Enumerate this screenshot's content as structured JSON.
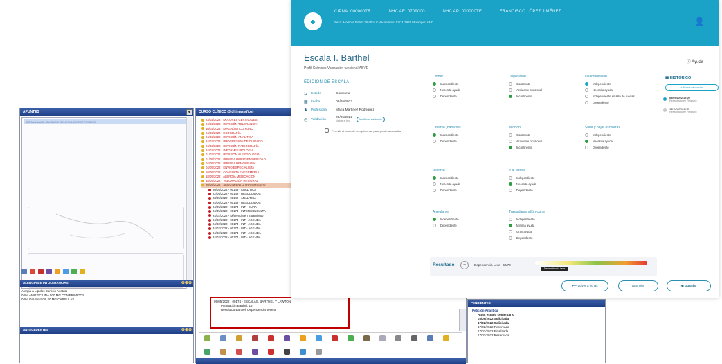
{
  "legacy": {
    "title": "APUNTES",
    "selected_item": "DD/MM/AAAA - CUIDADO GENERAL DE ENFERMERÍA",
    "section_alergias": "ALERGIAS E INTOLERANCIAS",
    "alergias_rows": [
      "Alergia a Lípidos Borricio Acetato",
      "0404    AMOXICILINA 500 MG COMPRIMIDOS",
      "0404    DIAPANZOL 20 MG CÁPSULAS"
    ],
    "section_antecedentes": "ANTECEDENTES"
  },
  "course": {
    "title": "CURSO CLÍNICO (3 últimas años)",
    "tree_items": [
      {
        "text": "23/02/2022 - DOLORES CERVICALES",
        "color": "red"
      },
      {
        "text": "24/02/2022 - REVISIÓN TOLERANCIA",
        "color": "red"
      },
      {
        "text": "10/02/2022 - DIAGNÓSTICO FUNC",
        "color": "red"
      },
      {
        "text": "24/02/2022 - ECOGRAFÍA",
        "color": "red"
      },
      {
        "text": "24/02/2022 - REVISIÓN ANALÍTICA",
        "color": "red"
      },
      {
        "text": "24/02/2022 - PROGRESIÓN DE CUIDADO",
        "color": "red"
      },
      {
        "text": "24/02/2022 - REVISIÓN RADIOGRAFÍA",
        "color": "red"
      },
      {
        "text": "24/02/2022 - INFORME UROLOGÍA",
        "color": "red"
      },
      {
        "text": "01/03/2022 - REVISIÓN ALERGOLOGÍA",
        "color": "red"
      },
      {
        "text": "01/05/2022 - PRUEBA HIPERSENSIBILIDAD",
        "color": "red"
      },
      {
        "text": "04/05/2022 - PRUEBA HEMOGRAMA",
        "color": "red"
      },
      {
        "text": "04/05/2022 - ENVÍO ESPECIALISTA",
        "color": "red"
      },
      {
        "text": "10/05/2022 - CONSULTA ENFERMERÍA",
        "color": "red"
      },
      {
        "text": "18/05/2022 - ALERGIA MEDICACIÓN",
        "color": "red"
      },
      {
        "text": "18/05/2022 - VALORACIÓN INTEGRAL",
        "color": "red"
      },
      {
        "text": "20/05/2022 - SEGUIMIENTO TRATAMIENTO",
        "color": "hl"
      },
      {
        "text": "20/05/2022 - 00149 - ANALÍTICA",
        "color": "blk"
      },
      {
        "text": "22/05/2022 - 00149 - RESULTADOS",
        "color": "blk"
      },
      {
        "text": "23/05/2022 - 00149 - ANALÍTICA",
        "color": "blk"
      },
      {
        "text": "24/05/2022 - 00149 - RESULTADOS",
        "color": "blk"
      },
      {
        "text": "24/05/2022 - 00174 - INT - CURA",
        "color": "blk"
      },
      {
        "text": "24/05/2022 - 00174 - INTERCONSULTA",
        "color": "blk"
      },
      {
        "text": "24/02/2022 - Diferencia en tratamiento",
        "color": "blk"
      },
      {
        "text": "24/02/2022 - 00174 - INT - AGENDA",
        "color": "blk"
      },
      {
        "text": "24/02/2022 - 00174 - INT - AGENDA",
        "color": "blk"
      },
      {
        "text": "24/02/2022 - 00174 - INT - AGENDA",
        "color": "blk"
      },
      {
        "text": "24/02/2022 - 00174 - INT - AGENDA",
        "color": "blk"
      },
      {
        "text": "24/02/2022 - 00174 - INT - AGENDA",
        "color": "blk"
      }
    ],
    "redbox_lines": [
      "09/05/2022 - 00174 - ESCALAS, BARTHEL Y LAWTON",
      "Puntuación Barthel: 15",
      "Resultado Barthel: Dependencia severa"
    ]
  },
  "pendientes": {
    "title": "PENDIENTES",
    "heading": "Petición Analítica",
    "lines": [
      {
        "text": "Rtdo. estado comentario",
        "bold": true
      },
      {
        "text": "03/05/2022 Solicitada",
        "bold": true
      },
      {
        "text": "17/02/2022 Solicitada",
        "bold": true
      },
      {
        "text": "17/02/2022 Reservada",
        "bold": false
      },
      {
        "text": "17/02/2022 Finalizada",
        "bold": false
      },
      {
        "text": "17/02/2022 Reservada",
        "bold": false
      }
    ]
  },
  "modern": {
    "patient": {
      "cipna": "CIPNA: 000000TR",
      "nhc": "NHC AE: 0709000",
      "nhc_ap": "NHC AP: 000000TE",
      "name": "FRANCISCO LÓPEZ JIMÉNEZ",
      "subline": "Sexo: Hombre  Edad: 38 años  F.Nacimiento: 03/11/1983  Municipio: AÑO"
    },
    "title": "Escala I. Barthel",
    "profile": "Perfil Crónicos   Valoración funcional ABVD",
    "help": "Ayuda",
    "edition": {
      "section": "EDICIÓN DE ESCALA",
      "estado_k": "Estado",
      "estado_v": "Completa",
      "fecha_k": "Fecha",
      "fecha_v": "09/05/2022",
      "prof_k": "Profesional",
      "prof_v": "María Martínez Rodríguez",
      "valid_k": "Validación",
      "valid_v": "09/05/2022",
      "valid_sub": "Validar el test",
      "pill": "Modificar validación",
      "check": "Permitir al paciente cumplimentar para próxima consulta"
    },
    "groups": [
      {
        "title": "Comer",
        "opts": [
          "Independiente",
          "Necesita ayuda",
          "Dependiente"
        ],
        "on": 0,
        "kind": "on"
      },
      {
        "title": "Deposición",
        "opts": [
          "Continente",
          "Accidente ocasional",
          "Incontinente"
        ],
        "on": 2,
        "kind": "on"
      },
      {
        "title": "Deambulación",
        "opts": [
          "Independiente",
          "Necesita ayuda",
          "Independiente en silla de ruedas",
          "Dependiente"
        ],
        "on": 0,
        "kind": "on2"
      },
      {
        "title": "Lavarse (bañarse)",
        "opts": [
          "Independiente",
          "Dependiente"
        ],
        "on": 0,
        "kind": "on"
      },
      {
        "title": "Micción",
        "opts": [
          "Continente",
          "Accidente ocasional",
          "Incontinente"
        ],
        "on": 2,
        "kind": "on"
      },
      {
        "title": "Subir y bajar escaleras",
        "opts": [
          "Independiente",
          "Necesita ayuda",
          "Dependiente"
        ],
        "on": 1,
        "kind": "on"
      },
      {
        "title": "Vestirse",
        "opts": [
          "Independiente",
          "Necesita ayuda",
          "Dependiente"
        ],
        "on": 0,
        "kind": "on"
      },
      {
        "title": "Ir al retrete",
        "opts": [
          "Independiente",
          "Necesita ayuda",
          "Dependiente"
        ],
        "on": 1,
        "kind": "on"
      },
      {
        "title": "Arreglarse",
        "opts": [
          "Independiente",
          "Dependiente"
        ],
        "on": 0,
        "kind": "on"
      },
      {
        "title": "Trasladarse sillón-cama",
        "opts": [
          "Independiente",
          "Mínima ayuda",
          "Gran ayuda",
          "Dependiente"
        ],
        "on": 1,
        "kind": "on"
      }
    ],
    "result": {
      "label": "Resultado",
      "value": "Dependencia Leve · 60/70",
      "tag": "Dependencia leve"
    },
    "actions": {
      "back": "Volver a fichas",
      "print": "Enviar",
      "save": "Guardar"
    },
    "history": {
      "title": "HISTÓRICO",
      "add": "+ Nueva valoración",
      "items": [
        {
          "date": "09/05/2022 12:00",
          "sub": "Ressultado en Registro",
          "active": true
        },
        {
          "date": "14/10/2021 11:15",
          "sub": "Ressultado en Registro",
          "active": false
        }
      ]
    }
  }
}
